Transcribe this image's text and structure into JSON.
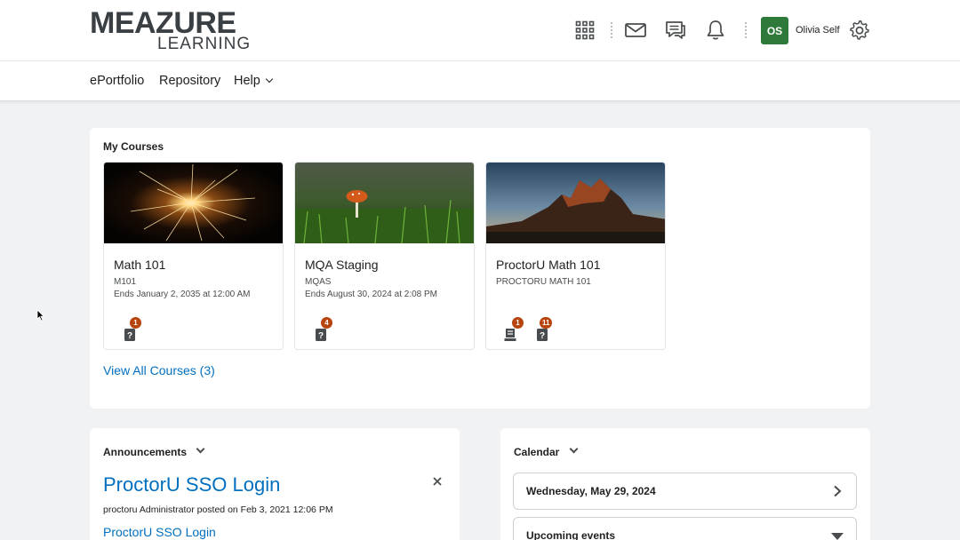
{
  "header": {
    "logo_line1": "MEAZURE",
    "logo_line2": "LEARNING",
    "user_initials": "OS",
    "user_name": "Olivia Self"
  },
  "nav": {
    "items": [
      {
        "label": "ePortfolio"
      },
      {
        "label": "Repository"
      },
      {
        "label": "Help"
      }
    ]
  },
  "my_courses": {
    "title": "My Courses",
    "cards": [
      {
        "name": "Math 101",
        "code": "M101",
        "ends": "Ends January 2, 2035 at 12:00 AM",
        "badges": [
          {
            "icon": "quiz-icon",
            "count": "1"
          }
        ]
      },
      {
        "name": "MQA Staging",
        "code": "MQAS",
        "ends": "Ends August 30, 2024 at 2:08 PM",
        "badges": [
          {
            "icon": "quiz-icon",
            "count": "4"
          }
        ]
      },
      {
        "name": "ProctorU Math 101",
        "code": "PROCTORU MATH 101",
        "ends": "",
        "badges": [
          {
            "icon": "assignment-icon",
            "count": "1"
          },
          {
            "icon": "quiz-icon",
            "count": "11"
          }
        ]
      }
    ],
    "view_all": "View All Courses (3)"
  },
  "announcements": {
    "title": "Announcements",
    "item_title": "ProctorU SSO Login",
    "item_meta": "proctoru Administrator posted on Feb 3, 2021 12:06 PM",
    "item_link": "ProctorU SSO Login"
  },
  "calendar": {
    "title": "Calendar",
    "date": "Wednesday, May 29, 2024",
    "upcoming": "Upcoming events"
  },
  "colors": {
    "accent_link": "#006fbf",
    "badge": "#b7430d",
    "avatar": "#2f7a3a"
  }
}
